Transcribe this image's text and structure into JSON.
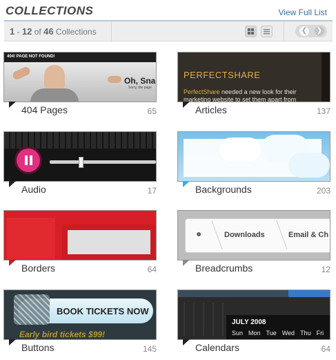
{
  "header": {
    "title": "COLLECTIONS",
    "view_full_list": "View Full List"
  },
  "toolbar": {
    "range_start": "1",
    "range_dash": "-",
    "range_end": "12",
    "of": "of",
    "total": "46",
    "unit": "Collections",
    "view_grid_icon": "grid-icon",
    "view_list_icon": "list-icon",
    "prev_icon": "chevron-left-icon",
    "next_icon": "chevron-right-icon"
  },
  "collections": [
    {
      "label": "404 Pages",
      "count": "65",
      "thumb": {
        "banner": "404! PAGE NOT FOUND!",
        "headline": "Oh, Sna",
        "sub": "Sorry, the page"
      }
    },
    {
      "label": "Articles",
      "count": "137",
      "thumb": {
        "title": "PERFECTSHARE",
        "body_highlight": "PerfectShare",
        "body": "needed a new look for their marketing website to set them apart from"
      }
    },
    {
      "label": "Audio",
      "count": "17"
    },
    {
      "label": "Backgrounds",
      "count": "203"
    },
    {
      "label": "Borders",
      "count": "64"
    },
    {
      "label": "Breadcrumbs",
      "count": "12",
      "thumb": {
        "crumb1": "Downloads",
        "crumb2": "Email & Ch"
      }
    },
    {
      "label": "Buttons",
      "count": "145",
      "thumb": {
        "button": "BOOK TICKETS NOW",
        "tagline": "Early bird tickets $99!"
      }
    },
    {
      "label": "Calendars",
      "count": "64",
      "thumb": {
        "month": "JULY 2008",
        "days": [
          "Sun",
          "Mon",
          "Tue",
          "Wed",
          "Thu",
          "Fri"
        ]
      }
    }
  ]
}
